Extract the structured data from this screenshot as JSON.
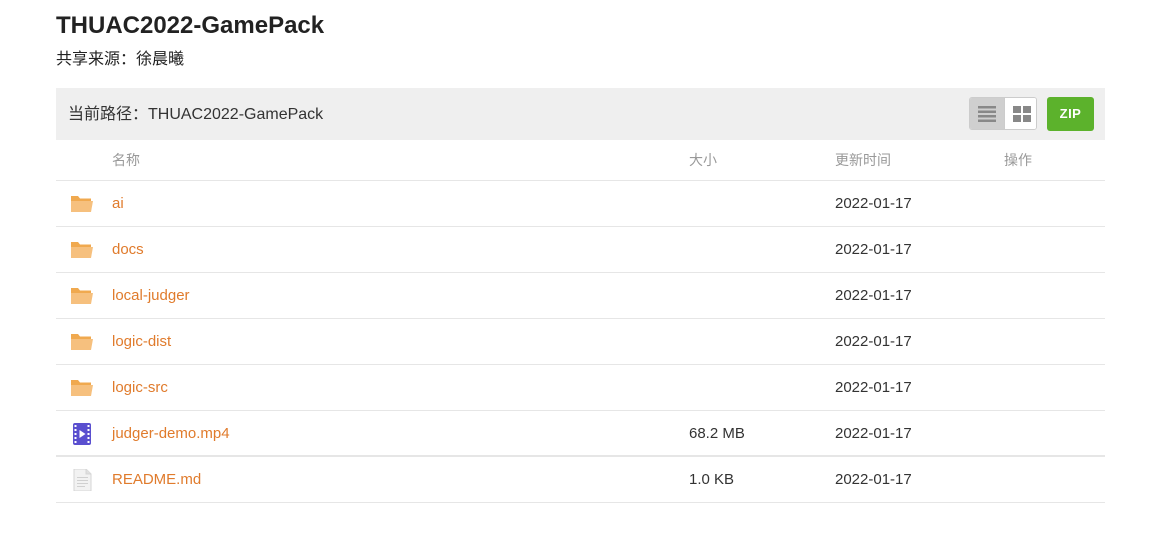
{
  "page": {
    "title": "THUAC2022-GamePack",
    "share_source": "共享来源：徐晨曦"
  },
  "pathbar": {
    "current_path": "当前路径：THUAC2022-GamePack",
    "zip_label": "ZIP",
    "views": [
      "list-view-icon",
      "grid-view-icon"
    ]
  },
  "table": {
    "headers": {
      "name": "名称",
      "size": "大小",
      "updated": "更新时间",
      "actions": "操作"
    },
    "rows": [
      {
        "icon": "folder-icon",
        "name": "ai",
        "size": "",
        "date": "2022-01-17"
      },
      {
        "icon": "folder-icon",
        "name": "docs",
        "size": "",
        "date": "2022-01-17"
      },
      {
        "icon": "folder-icon",
        "name": "local-judger",
        "size": "",
        "date": "2022-01-17"
      },
      {
        "icon": "folder-icon",
        "name": "logic-dist",
        "size": "",
        "date": "2022-01-17"
      },
      {
        "icon": "folder-icon",
        "name": "logic-src",
        "size": "",
        "date": "2022-01-17"
      },
      {
        "icon": "video-file-icon",
        "name": "judger-demo.mp4",
        "size": "68.2 MB",
        "date": "2022-01-17"
      },
      {
        "icon": "document-file-icon",
        "name": "README.md",
        "size": "1.0 KB",
        "date": "2022-01-17"
      }
    ]
  },
  "colors": {
    "link": "#e07b2c",
    "folder": "#f3b267",
    "zip_button": "#5cb22c",
    "pathbar_bg": "#efefef",
    "video_icon": "#5a4fcf"
  }
}
